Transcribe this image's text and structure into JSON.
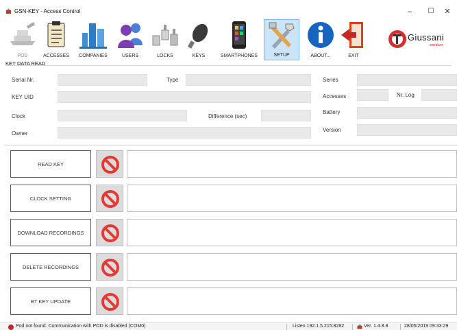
{
  "window": {
    "title": "GSN-KEY - Access Control",
    "minimize": "–",
    "maximize": "☐",
    "close": "✕"
  },
  "toolbar": {
    "items": [
      {
        "label": "POD",
        "icon": "pod-icon",
        "disabled": true
      },
      {
        "label": "ACCESSES",
        "icon": "clipboard-icon"
      },
      {
        "label": "COMPANIES",
        "icon": "buildings-icon"
      },
      {
        "label": "USERS",
        "icon": "users-icon"
      },
      {
        "label": "LOCKS",
        "icon": "locks-icon"
      },
      {
        "label": "KEYS",
        "icon": "key-fob-icon"
      },
      {
        "label": "SMARTPHONES",
        "icon": "smartphone-icon"
      },
      {
        "label": "SETUP",
        "icon": "tools-icon",
        "active": true
      },
      {
        "label": "ABOUT...",
        "icon": "info-icon"
      },
      {
        "label": "EXIT",
        "icon": "exit-door-icon"
      }
    ],
    "logo_text": "Giussani",
    "logo_subtext": "serrature"
  },
  "key_data": {
    "section_title": "KEY DATA READ",
    "serial_label": "Serial Nr.",
    "type_label": "Type",
    "series_label": "Series",
    "uid_label": "KEY UID",
    "accesses_label": "Accesses",
    "nrlog_label": "Nr. Log",
    "clock_label": "Clock",
    "difference_label": "Difference (sec)",
    "battery_label": "Battery",
    "owner_label": "Owner",
    "version_label": "Version"
  },
  "actions": [
    {
      "label": "READ KEY"
    },
    {
      "label": "CLOCK SETTING"
    },
    {
      "label": "DOWNLOAD RECORDINGS"
    },
    {
      "label": "DELETE RECORDINGS"
    },
    {
      "label": "BT KEY UPDATE"
    }
  ],
  "status": {
    "message": "Pod not found. Communication with POD is disabled (COM0)",
    "listen": "Listen 192.1.5.215:8282",
    "version": "Ver. 1.4.8.8",
    "datetime": "28/05/2019 09:33:29"
  },
  "colors": {
    "active_tool_bg": "#cce4f7",
    "stop_red": "#e53935",
    "field_bg": "#e9e9e9"
  }
}
